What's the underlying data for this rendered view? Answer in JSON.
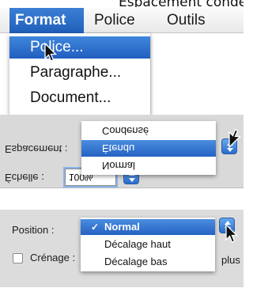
{
  "caption": {
    "text": "Espacement condensé"
  },
  "format_menu": {
    "menubar": {
      "format": "Format",
      "police": "Police",
      "outils": "Outils"
    },
    "items": [
      "Police...",
      "Paragraphe...",
      "Document..."
    ],
    "highlighted_index": 0,
    "accent_color": "#2866c6"
  },
  "espacement_panel": {
    "label_espacement": "Espacement :",
    "label_echelle": "Échelle :",
    "scale_value": "100%",
    "options": [
      "Condensé",
      "Étendu",
      "Normal"
    ],
    "highlighted_index": 1,
    "mirrored": true
  },
  "position_panel": {
    "label_position": "Position :",
    "options": [
      "Normal",
      "Décalage haut",
      "Décalage bas"
    ],
    "selected_index": 0,
    "checkmark": "✓",
    "kerning_label": "Crénage :",
    "trailing_text": "plus",
    "kerning_checked": false
  }
}
